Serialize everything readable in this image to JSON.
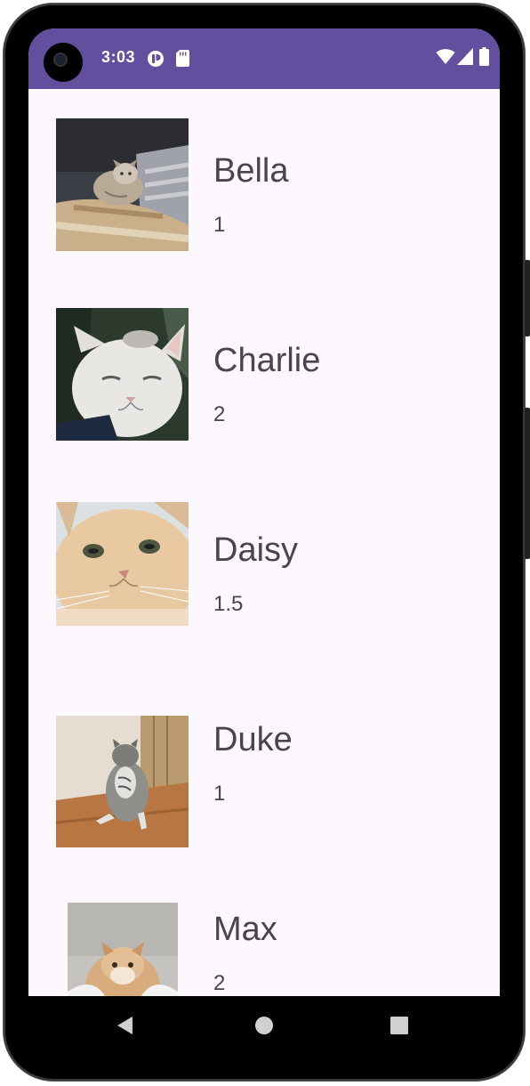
{
  "status_bar": {
    "time": "3:03",
    "color": "#624f9d",
    "left_icons": [
      "app-notification-icon",
      "sd-card-icon"
    ],
    "right_icons": [
      "wifi-icon",
      "cell-signal-icon",
      "battery-icon"
    ]
  },
  "pets": [
    {
      "name": "Bella",
      "age": "1"
    },
    {
      "name": "Charlie",
      "age": "2"
    },
    {
      "name": "Daisy",
      "age": "1.5"
    },
    {
      "name": "Duke",
      "age": "1"
    },
    {
      "name": "Max",
      "age": "2"
    }
  ],
  "nav_bar": {
    "buttons": [
      "back-icon",
      "home-icon",
      "recents-icon"
    ]
  }
}
